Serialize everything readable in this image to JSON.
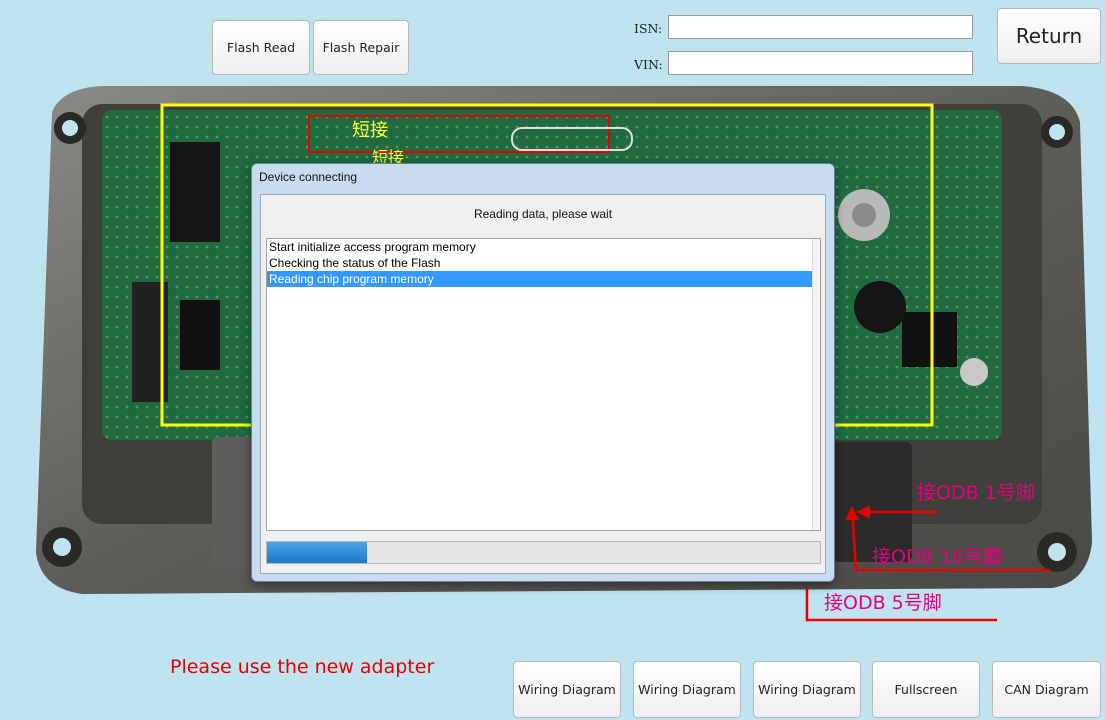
{
  "toolbar": {
    "flash_read": "Flash Read",
    "flash_repair": "Flash Repair",
    "return": "Return"
  },
  "fields": {
    "isn_label": "ISN:",
    "isn_value": "",
    "vin_label": "VIN:",
    "vin_value": ""
  },
  "board_labels": {
    "short_connect": "短接",
    "short_connect_2": "短接",
    "obd_pin1": "接ODB 1号脚",
    "obd_pin16": "接ODB 16号脚",
    "obd_pin5": "接ODB 5号脚"
  },
  "dialog": {
    "title": "Device connecting",
    "message": "Reading data, please wait",
    "log": [
      "Start initialize access program memory",
      "Checking the status of the Flash",
      "Reading chip program memory"
    ],
    "selected_index": 2,
    "progress": 0.18
  },
  "footer": {
    "note": "Please use the new adapter",
    "buttons": [
      "Wiring Diagram",
      "Wiring Diagram",
      "Wiring Diagram",
      "Fullscreen",
      "CAN Diagram"
    ]
  },
  "colors": {
    "background": "#bfe3ef",
    "highlight_box": "#ffff00",
    "annotation": "#e8007a",
    "arrow": "#e60000",
    "note": "#e60000",
    "selection": "#3399ff",
    "progress": "#1d78c8"
  }
}
